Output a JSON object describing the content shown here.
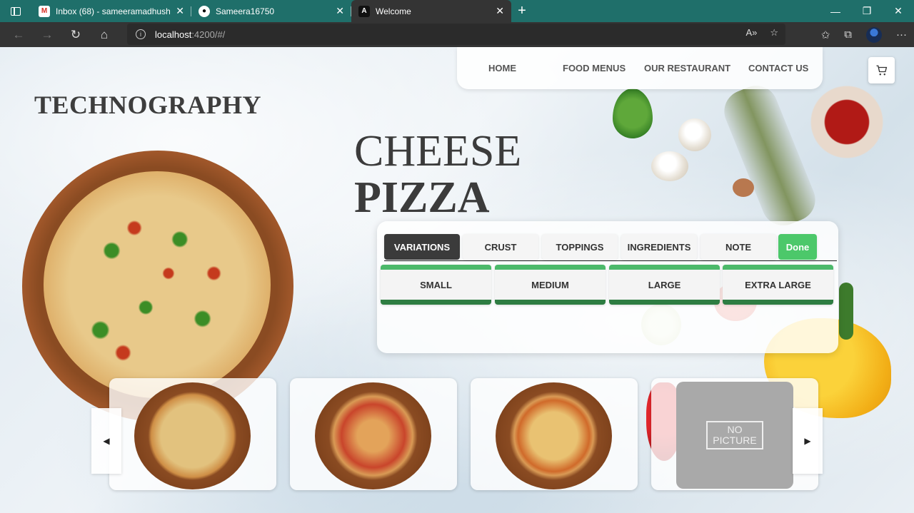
{
  "browser": {
    "tabs": [
      {
        "title": "Inbox (68) - sameeramadhushan",
        "icon": "gmail-icon"
      },
      {
        "title": "Sameera16750",
        "icon": "github-icon"
      },
      {
        "title": "Welcome",
        "icon": "angular-icon"
      }
    ],
    "url_host": "localhost",
    "url_path": ":4200/#/"
  },
  "site": {
    "brand": "TECHNOGRAPHY",
    "nav": [
      "HOME",
      "FOOD MENUS",
      "OUR RESTAURANT",
      "CONTACT US"
    ],
    "cart_icon": "cart-icon"
  },
  "hero": {
    "title_line1": "CHEESE",
    "title_line2": "PIZZA"
  },
  "options": {
    "tabs": [
      "VARIATIONS",
      "CRUST",
      "TOPPINGS",
      "INGREDIENTS",
      "NOTE"
    ],
    "active_tab": "VARIATIONS",
    "done_label": "Done",
    "sizes": [
      "SMALL",
      "MEDIUM",
      "LARGE",
      "EXTRA LARGE"
    ]
  },
  "carousel": {
    "no_picture_line1": "NO",
    "no_picture_line2": "PICTURE"
  },
  "colors": {
    "tabbar": "#1f6f6a",
    "done_green": "#4cc86a",
    "size_top": "#4cb96a",
    "size_bottom": "#2e7d42"
  }
}
